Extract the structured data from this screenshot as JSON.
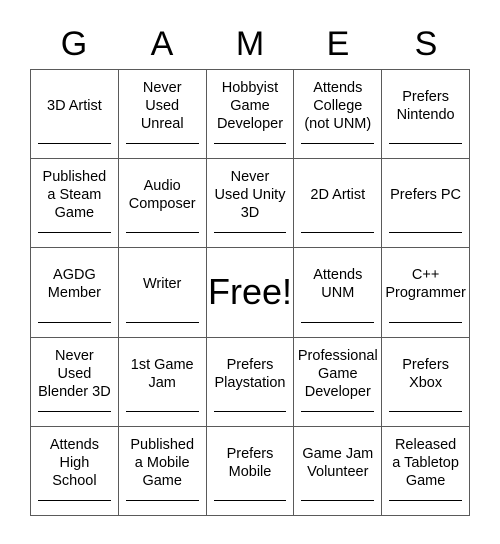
{
  "card": {
    "title_letters": [
      "G",
      "A",
      "M",
      "E",
      "S"
    ],
    "free_space_label": "Free!",
    "rows": [
      [
        {
          "label": "3D Artist",
          "free": false,
          "signature_line": true
        },
        {
          "label": "Never\nUsed\nUnreal",
          "free": false,
          "signature_line": true
        },
        {
          "label": "Hobbyist\nGame\nDeveloper",
          "free": false,
          "signature_line": true
        },
        {
          "label": "Attends\nCollege\n(not UNM)",
          "free": false,
          "signature_line": true
        },
        {
          "label": "Prefers\nNintendo",
          "free": false,
          "signature_line": true
        }
      ],
      [
        {
          "label": "Published\na Steam\nGame",
          "free": false,
          "signature_line": true
        },
        {
          "label": "Audio\nComposer",
          "free": false,
          "signature_line": true
        },
        {
          "label": "Never\nUsed Unity\n3D",
          "free": false,
          "signature_line": true
        },
        {
          "label": "2D Artist",
          "free": false,
          "signature_line": true
        },
        {
          "label": "Prefers PC",
          "free": false,
          "signature_line": true
        }
      ],
      [
        {
          "label": "AGDG\nMember",
          "free": false,
          "signature_line": true
        },
        {
          "label": "Writer",
          "free": false,
          "signature_line": true
        },
        {
          "label": "Free!",
          "free": true,
          "signature_line": false
        },
        {
          "label": "Attends\nUNM",
          "free": false,
          "signature_line": true
        },
        {
          "label": "C++\nProgrammer",
          "free": false,
          "signature_line": true
        }
      ],
      [
        {
          "label": "Never\nUsed\nBlender 3D",
          "free": false,
          "signature_line": true
        },
        {
          "label": "1st Game\nJam",
          "free": false,
          "signature_line": true
        },
        {
          "label": "Prefers\nPlaystation",
          "free": false,
          "signature_line": true
        },
        {
          "label": "Professional\nGame\nDeveloper",
          "free": false,
          "signature_line": true
        },
        {
          "label": "Prefers\nXbox",
          "free": false,
          "signature_line": true
        }
      ],
      [
        {
          "label": "Attends\nHigh\nSchool",
          "free": false,
          "signature_line": true
        },
        {
          "label": "Published\na Mobile\nGame",
          "free": false,
          "signature_line": true
        },
        {
          "label": "Prefers\nMobile",
          "free": false,
          "signature_line": true
        },
        {
          "label": "Game Jam\nVolunteer",
          "free": false,
          "signature_line": true
        },
        {
          "label": "Released\na Tabletop\nGame",
          "free": false,
          "signature_line": true
        }
      ]
    ],
    "colors": {
      "background": "#ffffff",
      "text": "#000000",
      "grid_line": "#5a5a5a",
      "signature_line": "#000000"
    }
  }
}
